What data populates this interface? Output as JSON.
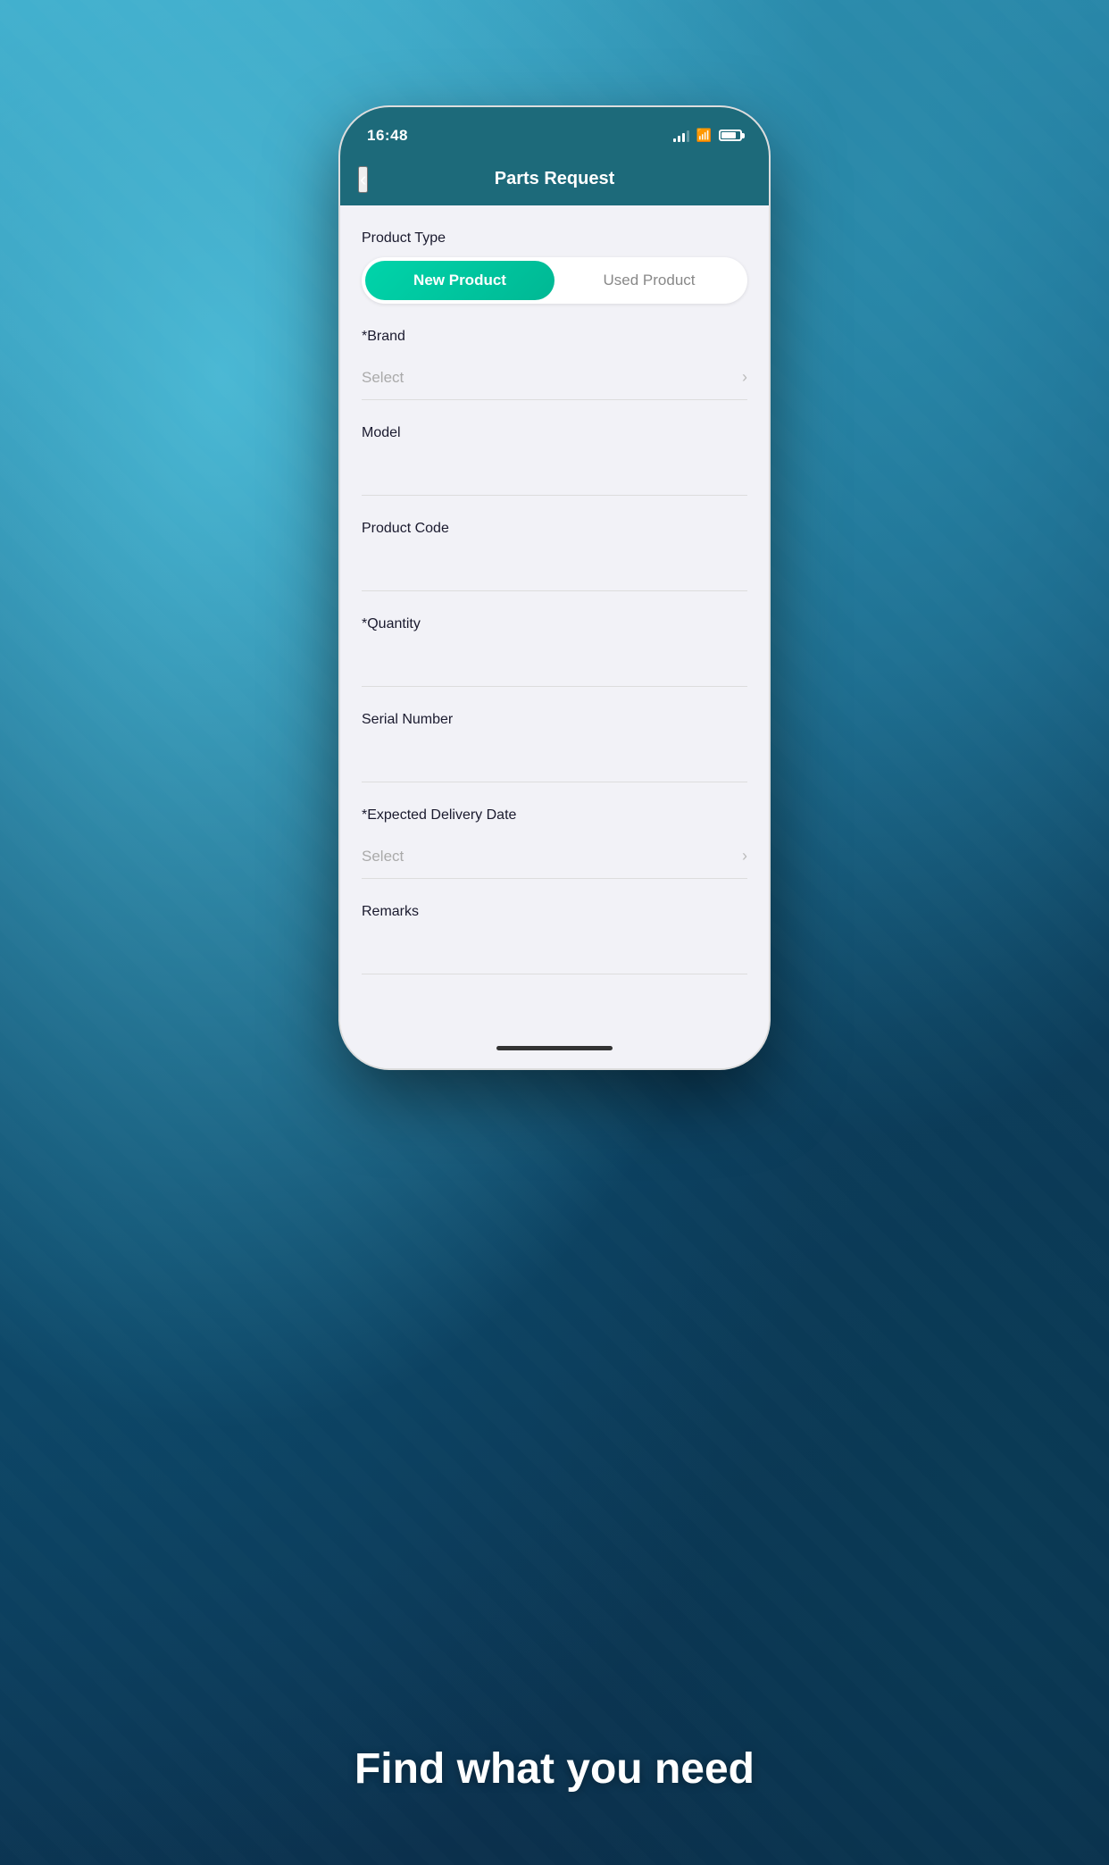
{
  "statusBar": {
    "time": "16:48",
    "signalLabel": "signal",
    "wifiLabel": "wifi",
    "batteryLabel": "battery"
  },
  "header": {
    "title": "Parts Request",
    "backLabel": "‹"
  },
  "form": {
    "productType": {
      "label": "Product Type",
      "options": [
        {
          "id": "new",
          "label": "New Product",
          "active": true
        },
        {
          "id": "used",
          "label": "Used Product",
          "active": false
        }
      ]
    },
    "brand": {
      "label": "*Brand",
      "placeholder": "Select"
    },
    "model": {
      "label": "Model",
      "placeholder": ""
    },
    "productCode": {
      "label": "Product Code",
      "placeholder": ""
    },
    "quantity": {
      "label": "*Quantity",
      "placeholder": ""
    },
    "serialNumber": {
      "label": "Serial Number",
      "placeholder": ""
    },
    "expectedDeliveryDate": {
      "label": "*Expected Delivery Date",
      "placeholder": "Select"
    },
    "remarks": {
      "label": "Remarks",
      "placeholder": ""
    }
  },
  "bottomText": "Find what you need"
}
